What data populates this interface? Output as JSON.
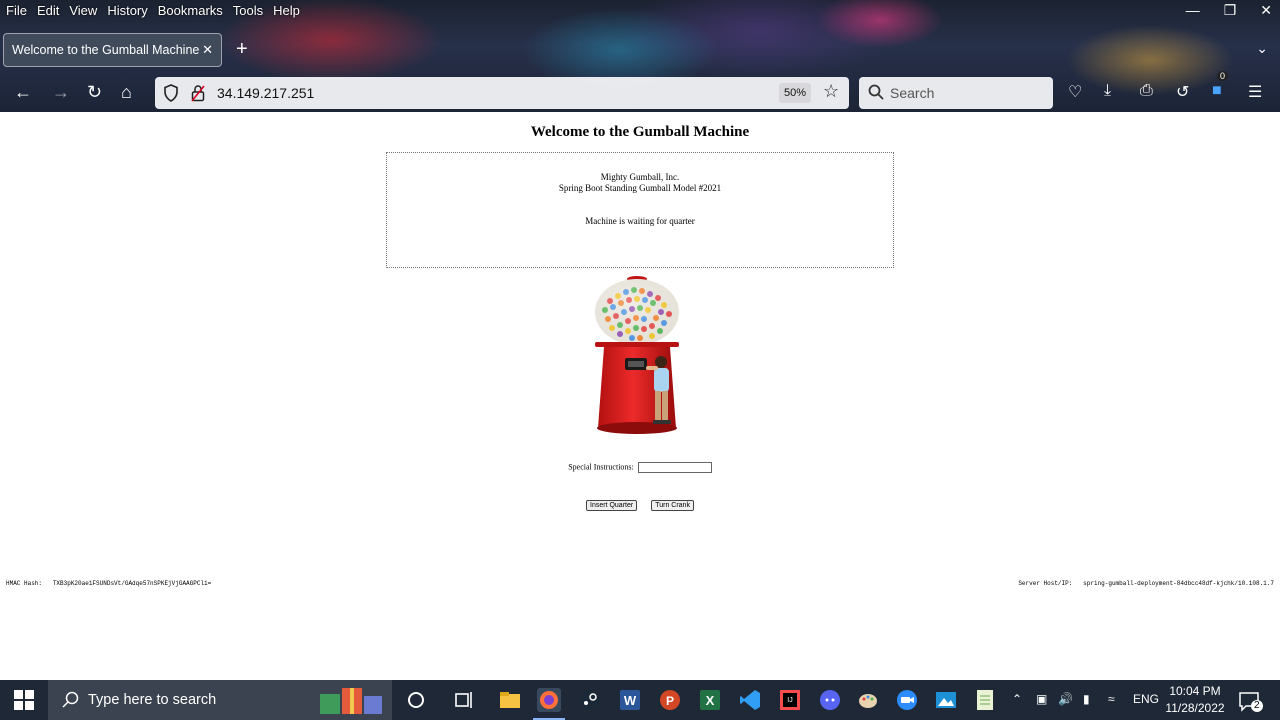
{
  "browser": {
    "menu": [
      "File",
      "Edit",
      "View",
      "History",
      "Bookmarks",
      "Tools",
      "Help"
    ],
    "tab_title": "Welcome to the Gumball Machine",
    "url": "34.149.217.251",
    "zoom": "50%",
    "search_placeholder": "Search",
    "extension_badge": "0"
  },
  "page": {
    "title": "Welcome to the Gumball Machine",
    "company": "Mighty Gumball, Inc.",
    "model": "Spring Boot Standing Gumball Model #2021",
    "status": "Machine is waiting for quarter",
    "instructions_label": "Special Instructions:",
    "instructions_value": "",
    "insert_quarter_label": "Insert Quarter",
    "turn_crank_label": "Turn Crank",
    "hmac_label": "HMAC Hash:",
    "hmac_value": "TXB3pK20ae1FSUNDsVt/GAdqe57nSPKEjVjGAAGPCl1=",
    "server_label": "Server Host/IP:",
    "server_value": "spring-gumball-deployment-84dbcc48df-kjchk/10.108.1.7"
  },
  "taskbar": {
    "search_placeholder": "Type here to search",
    "language": "ENG",
    "time": "10:04 PM",
    "date": "11/28/2022",
    "notification_count": "2"
  },
  "colors": {
    "taskbar_bg": "#1f2836",
    "gumball_red": "#d81e1e"
  }
}
